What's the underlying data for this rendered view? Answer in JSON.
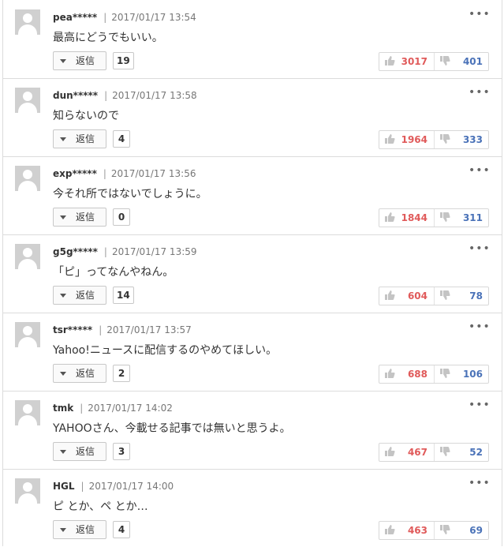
{
  "comments": [
    {
      "username": "pea*****",
      "timestamp": "2017/01/17 13:54",
      "text": "最高にどうでもいい。",
      "reply_label": "返信",
      "reply_count": "19",
      "likes": "3017",
      "dislikes": "401"
    },
    {
      "username": "dun*****",
      "timestamp": "2017/01/17 13:58",
      "text": "知らないので",
      "reply_label": "返信",
      "reply_count": "4",
      "likes": "1964",
      "dislikes": "333"
    },
    {
      "username": "exp*****",
      "timestamp": "2017/01/17 13:56",
      "text": "今それ所ではないでしょうに。",
      "reply_label": "返信",
      "reply_count": "0",
      "likes": "1844",
      "dislikes": "311"
    },
    {
      "username": "g5g*****",
      "timestamp": "2017/01/17 13:59",
      "text": "「ピ」ってなんやねん。",
      "reply_label": "返信",
      "reply_count": "14",
      "likes": "604",
      "dislikes": "78"
    },
    {
      "username": "tsr*****",
      "timestamp": "2017/01/17 13:57",
      "text": "Yahoo!ニュースに配信するのやめてほしい。",
      "reply_label": "返信",
      "reply_count": "2",
      "likes": "688",
      "dislikes": "106"
    },
    {
      "username": "tmk",
      "timestamp": "2017/01/17 14:02",
      "text": "YAHOOさん、今載せる記事では無いと思うよ。",
      "reply_label": "返信",
      "reply_count": "3",
      "likes": "467",
      "dislikes": "52"
    },
    {
      "username": "HGL",
      "timestamp": "2017/01/17 14:00",
      "text": "ピ とか、ペ とか…",
      "reply_label": "返信",
      "reply_count": "4",
      "likes": "463",
      "dislikes": "69"
    }
  ],
  "icons": {
    "avatar": "default-avatar-icon",
    "more": "more-horizontal-icon",
    "reply_toggle": "caret-down-icon",
    "like": "thumbs-up-icon",
    "dislike": "thumbs-down-icon"
  },
  "colors": {
    "like_count": "#e05a5a",
    "dislike_count": "#4a72b8",
    "border": "#dcdcdc"
  }
}
